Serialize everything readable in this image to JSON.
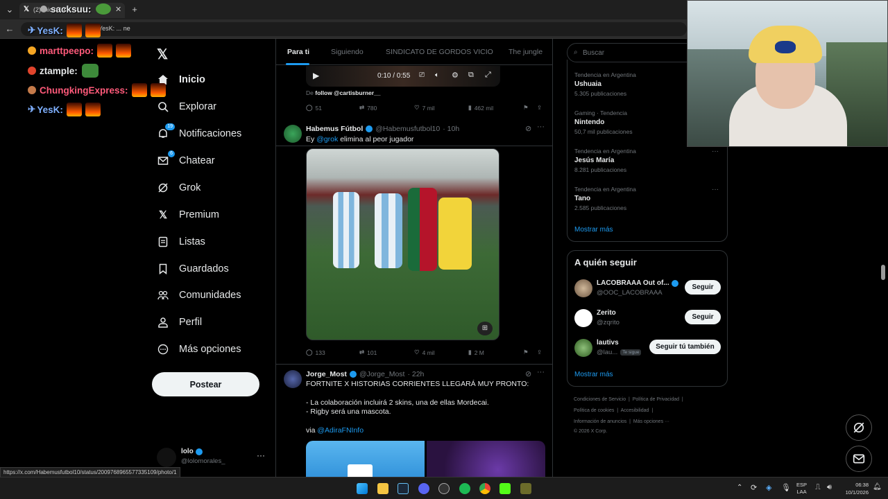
{
  "browser": {
    "tab_title": "(2) Inicio / X",
    "address_text": "YesK: ... ne",
    "status_url": "https://x.com/Habemusfutbol10/status/2009768965577335109/photo/1"
  },
  "chat_overlay": [
    {
      "user": "sacksuu:",
      "color": "#ffffff"
    },
    {
      "user": "YesK:",
      "color": "#7fb0ff"
    },
    {
      "user": "marttpeepo:",
      "color": "#ff5a7a"
    },
    {
      "user": "ztample:",
      "color": "#ffffff"
    },
    {
      "user": "ChungkingExpress:",
      "color": "#ff5a7a"
    },
    {
      "user": "YesK:",
      "color": "#7fb0ff"
    }
  ],
  "nav": {
    "items": [
      {
        "label": "Inicio",
        "icon": "home-icon"
      },
      {
        "label": "Explorar",
        "icon": "search-icon"
      },
      {
        "label": "Notificaciones",
        "icon": "bell-icon",
        "badge": "19"
      },
      {
        "label": "Chatear",
        "icon": "mail-icon",
        "badge": "6"
      },
      {
        "label": "Grok",
        "icon": "grok-icon"
      },
      {
        "label": "Premium",
        "icon": "x-logo-icon"
      },
      {
        "label": "Listas",
        "icon": "list-icon"
      },
      {
        "label": "Guardados",
        "icon": "bookmark-icon"
      },
      {
        "label": "Comunidades",
        "icon": "communities-icon"
      },
      {
        "label": "Perfil",
        "icon": "user-icon"
      },
      {
        "label": "Más opciones",
        "icon": "more-icon"
      }
    ],
    "post_button": "Postear",
    "account": {
      "name": "lolo",
      "handle": "@lolomorales_"
    }
  },
  "tabs": [
    "Para ti",
    "Siguiendo",
    "SINDICATO DE GORDOS VICIO",
    "The jungle"
  ],
  "video_post": {
    "time": "0:10 / 0:55",
    "from_label": "De",
    "from_link": "follow @cartisburner__",
    "replies": "51",
    "reposts": "780",
    "likes": "7 mil",
    "views": "462 mil"
  },
  "post1": {
    "name": "Habemus Fútbol",
    "handle": "@Habemusfutbol10",
    "time": "· 10h",
    "text_prefix": "Ey",
    "mention": "@grok",
    "text_suffix": "elimina al peor jugador",
    "replies": "133",
    "reposts": "101",
    "likes": "4 mil",
    "views": "2 M"
  },
  "post2": {
    "name": "Jorge_Most",
    "handle": "@Jorge_Most",
    "time": "· 22h",
    "line1": "FORTNITE X HISTORIAS CORRIENTES LLEGARÁ MUY PRONTO:",
    "line2": "- La colaboración incluirá 2 skins, una de ellas Mordecai.",
    "line3": "- Rigby será una mascota.",
    "via_label": "via",
    "via_link": "@AdiraFNInfo"
  },
  "search": {
    "placeholder": "Buscar"
  },
  "trends": [
    {
      "context": "Tendencia en Argentina",
      "name": "Ushuaia",
      "count": "5.305 publicaciones"
    },
    {
      "context": "Gaming · Tendencia",
      "name": "Nintendo",
      "count": "50,7 mil publicaciones"
    },
    {
      "context": "Tendencia en Argentina",
      "name": "Jesús María",
      "count": "8.281 publicaciones"
    },
    {
      "context": "Tendencia en Argentina",
      "name": "Tano",
      "count": "2.585 publicaciones"
    }
  ],
  "trends_more": "Mostrar más",
  "who_to_follow": {
    "title": "A quién seguir",
    "items": [
      {
        "name": "LACOBRAAA Out of...",
        "handle": "@OOC_LACOBRAAA",
        "button": "Seguir"
      },
      {
        "name": "Zerito",
        "handle": "@zqrito",
        "button": "Seguir"
      },
      {
        "name": "lautivs",
        "handle": "@lau...",
        "tag": "Te sigue",
        "button": "Seguir tú también"
      }
    ],
    "more": "Mostrar más"
  },
  "footer": {
    "line1": [
      "Condiciones de Servicio",
      "Política de Privacidad"
    ],
    "line2": [
      "Política de cookies",
      "Accesibilidad"
    ],
    "line3": [
      "Información de anuncios",
      "Más opciones ···"
    ],
    "copyright": "© 2026 X Corp."
  },
  "taskbar": {
    "lang1": "ESP",
    "lang2": "LAA",
    "time": "06:38",
    "date": "10/1/2026"
  }
}
